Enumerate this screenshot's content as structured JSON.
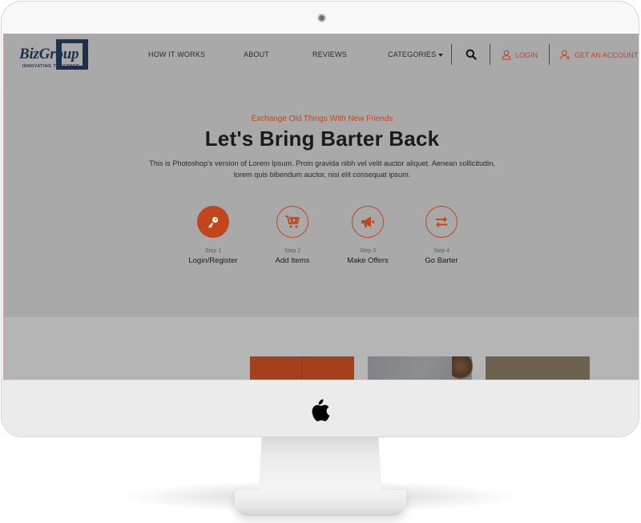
{
  "site": {
    "logo_text": "BizGroup",
    "logo_tagline": "INNOVATING TOGETHER"
  },
  "nav": {
    "items": [
      {
        "label": "HOW IT WORKS"
      },
      {
        "label": "ABOUT"
      },
      {
        "label": "REVIEWS"
      },
      {
        "label": "CATEGORIES"
      }
    ],
    "login_label": "LOGIN",
    "account_label": "GET AN ACCOUNT"
  },
  "hero": {
    "subtitle": "Exchange Old Things With New Friends",
    "title": "Let's Bring Barter Back",
    "description": "This is Photoshop's version  of Lorem Ipsum. Proin gravida nibh vel velit auctor aliquet. Aenean sollicitudin, lorem quis bibendum auctor, nisi elit consequat ipsum."
  },
  "steps": [
    {
      "number": "Step 1",
      "label": "Login/Register",
      "icon": "key-icon"
    },
    {
      "number": "Step 2",
      "label": "Add Items",
      "icon": "cart-plus-icon"
    },
    {
      "number": "Step 3",
      "label": "Make Offers",
      "icon": "megaphone-icon"
    },
    {
      "number": "Step 4",
      "label": "Go Barter",
      "icon": "exchange-arrows-icon"
    }
  ],
  "colors": {
    "accent": "#c2461b",
    "navy": "#1e3148",
    "overlay": "#a9a9a9"
  }
}
